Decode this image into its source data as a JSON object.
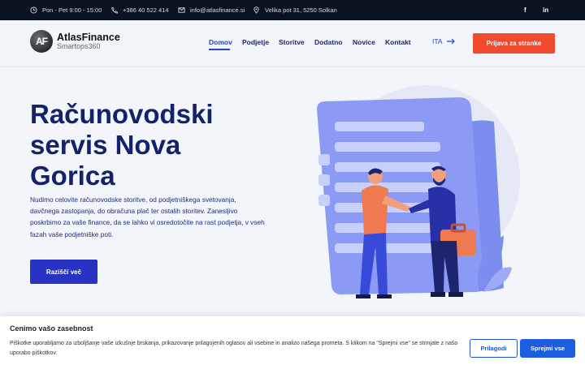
{
  "topbar": {
    "hours": "Pon - Pet 9:00 - 15:00",
    "phone": "+386 40 522 414",
    "email": "info@atlasfinance.si",
    "address": "Velika pot 31, 5250 Solkan",
    "social": [
      "f",
      "in"
    ]
  },
  "logo": {
    "badge": "AF",
    "name": "AtlasFinance",
    "sub": "Smartops360"
  },
  "nav": {
    "items": [
      "Domov",
      "Podjetje",
      "Storitve",
      "Dodatno",
      "Novice",
      "Kontakt"
    ],
    "active": "Domov",
    "lang": "ITA",
    "cta": "Prijava za stranke"
  },
  "hero": {
    "title": "Računovodski servis Nova Gorica",
    "description": "Nudimo celovite računovodske storitve, od podjetniškega svetovanja, davčnega zastopanja, do obračuna plač ter ostalih storitev. Zanesljivo poskrbimo za vaše finance, da se lahko vi osredotočite na rast podjetja, v vseh fazah vaše podjetniške poti.",
    "button": "Raziščí več"
  },
  "cookie": {
    "title": "Cenimo vašo zasebnost",
    "text": "Piškotke uporabljamo za izboljšanje vaše izkušnje brskanja, prikazovanje prilagojenih oglasov ali vsebine in analizo našega prometa. S klikom na \"Sprejmi vse\" se strinjate z našo uporabo piškotkov.",
    "customize": "Prilagodi",
    "accept": "Sprejmi vse"
  },
  "colors": {
    "primary": "#2833c4",
    "accent": "#f04a2f",
    "topbar": "#0b1220"
  }
}
